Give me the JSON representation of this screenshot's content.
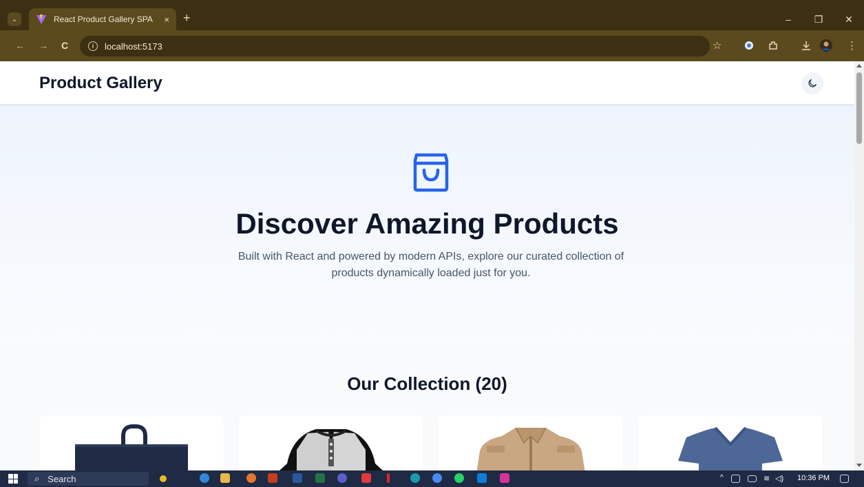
{
  "browser": {
    "tab_title": "React Product Gallery SPA",
    "tab_close": "×",
    "new_tab": "+",
    "url": "localhost:5173",
    "info_glyph": "i",
    "nav": {
      "back": "←",
      "forward": "→",
      "reload": "C"
    },
    "window_controls": {
      "minimize": "–",
      "restore": "❐",
      "close": "✕"
    }
  },
  "app": {
    "brand": "Product Gallery",
    "hero": {
      "title": "Discover Amazing Products",
      "subtitle": "Built with React and powered by modern APIs, explore our curated collection of products dynamically loaded just for you."
    },
    "collection": {
      "title": "Our Collection (20)",
      "products": [
        {
          "image": "navy-tote-bag"
        },
        {
          "image": "raglan-henley-tshirt"
        },
        {
          "image": "khaki-jacket"
        },
        {
          "image": "blue-vneck-tshirt"
        }
      ]
    },
    "accent_color": "#2563eb"
  },
  "taskbar": {
    "search_label": "Search",
    "time": "10:36 PM"
  },
  "icons": [
    "chevron-down-icon",
    "vite-favicon-icon",
    "info-icon",
    "star-icon",
    "extensions-icon",
    "download-icon",
    "kebab-menu-icon",
    "moon-icon",
    "shopping-bag-icon",
    "windows-start-icon",
    "search-icon"
  ]
}
